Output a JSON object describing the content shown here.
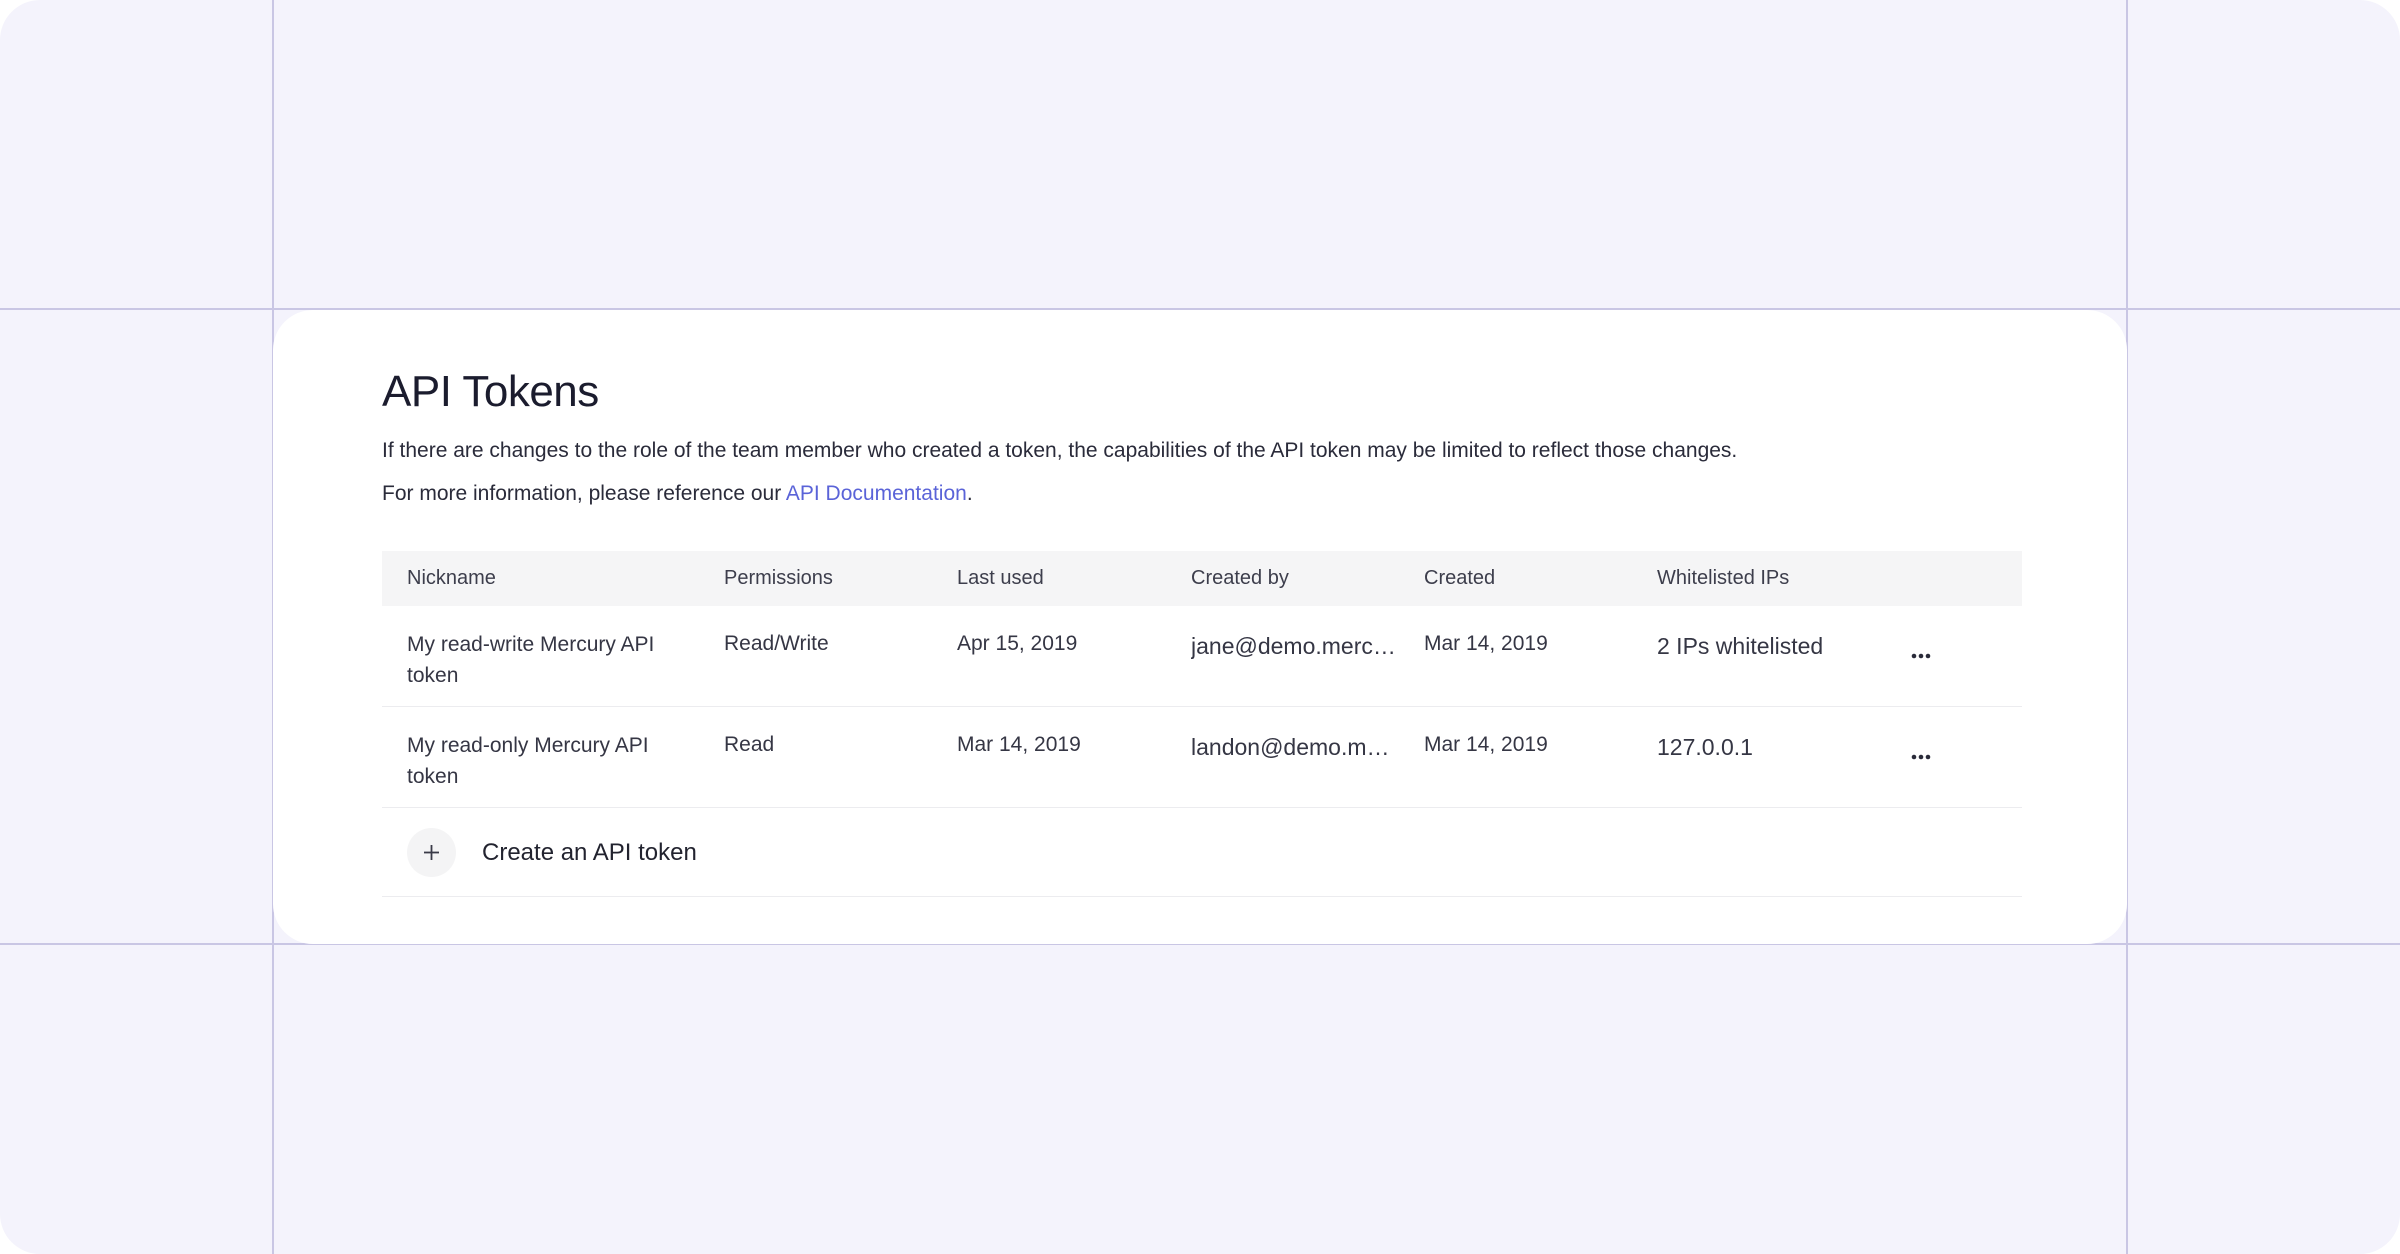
{
  "page": {
    "title": "API Tokens",
    "description": "If there are changes to the role of the team member who created a token, the capabilities of the API token may be limited to reflect those changes.",
    "info_prefix": "For more information, please reference our ",
    "info_link": "API Documentation",
    "info_suffix": "."
  },
  "table": {
    "headers": [
      "Nickname",
      "Permissions",
      "Last used",
      "Created by",
      "Created",
      "Whitelisted IPs"
    ],
    "rows": [
      {
        "nickname": "My read-write Mercury API token",
        "permissions": "Read/Write",
        "last_used": "Apr 15, 2019",
        "created_by": "jane@demo.merc…",
        "created": "Mar 14, 2019",
        "whitelisted_ips": "2 IPs whitelisted"
      },
      {
        "nickname": "My read-only Mercury API token",
        "permissions": "Read",
        "last_used": "Mar 14, 2019",
        "created_by": "landon@demo.me…",
        "created": "Mar 14, 2019",
        "whitelisted_ips": "127.0.0.1"
      }
    ]
  },
  "create": {
    "label": "Create an API token",
    "icon": "plus-icon"
  },
  "icons": {
    "row_actions": "more-horizontal-icon"
  },
  "colors": {
    "background": "#f4f3fc",
    "guide_lines": "#c9c6e4",
    "card": "#ffffff",
    "link": "#5a63d8",
    "table_header": "#f5f5f6",
    "text": "#1f2133"
  }
}
